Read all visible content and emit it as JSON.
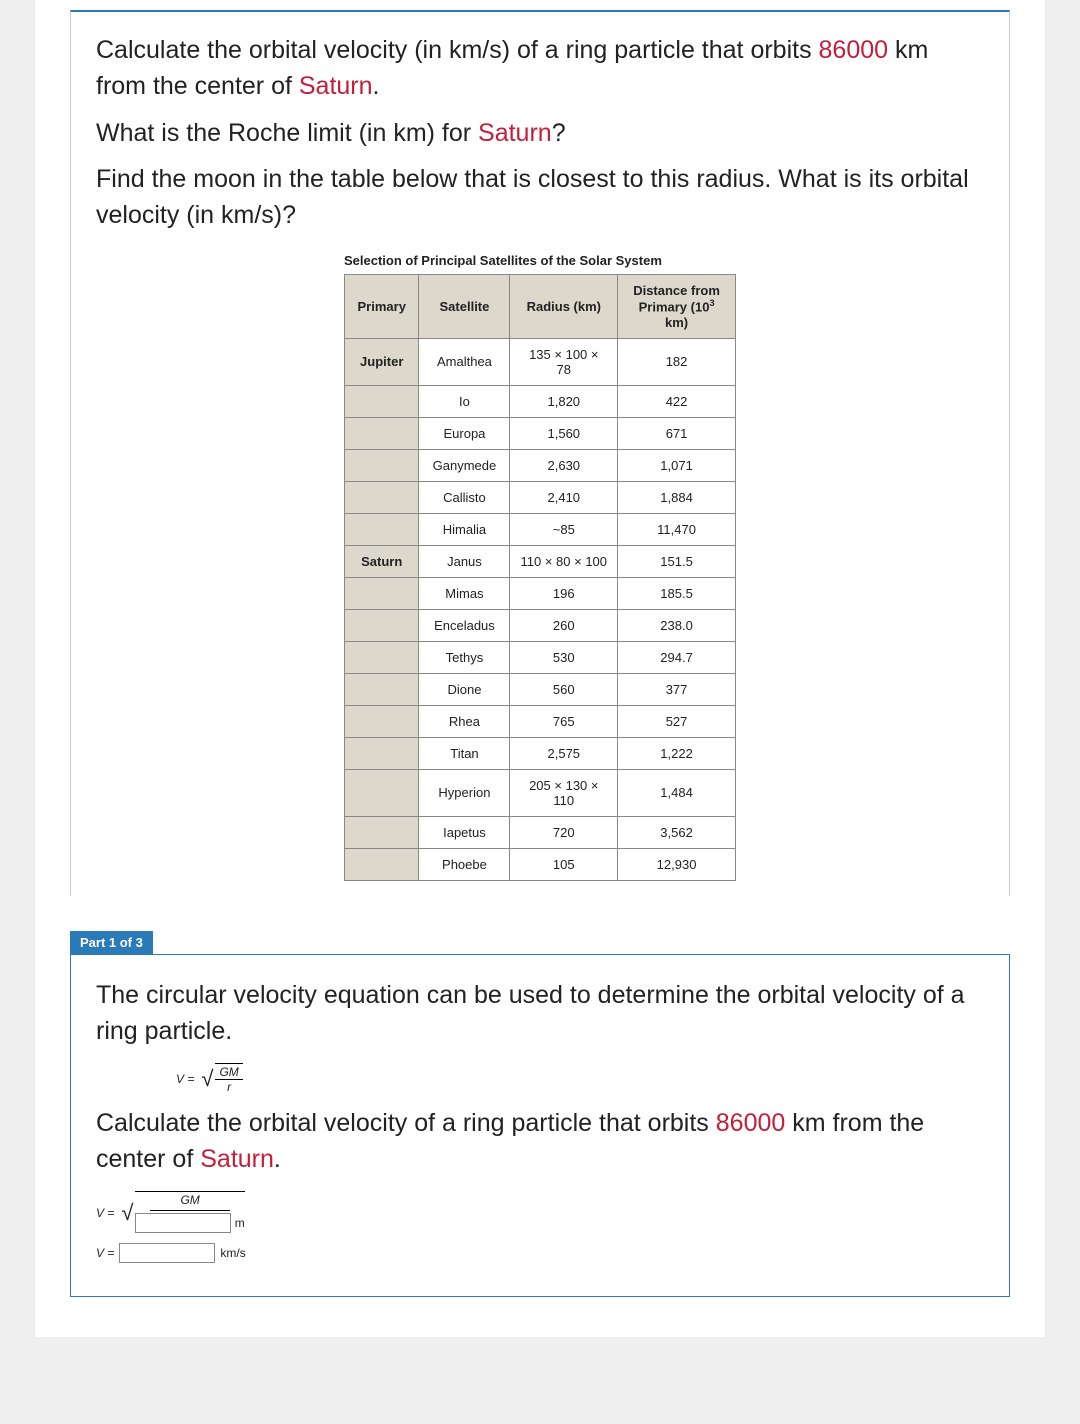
{
  "question": {
    "p1_pre": "Calculate the orbital velocity (in km/s) of a ring particle that orbits ",
    "p1_val": "86000",
    "p1_mid": " km from the center of ",
    "p1_planet": "Saturn",
    "p1_end": ".",
    "p2_pre": "What is the Roche limit (in km) for ",
    "p2_planet": "Saturn",
    "p2_end": "?",
    "p3": "Find the moon in the table below that is closest to this radius. What is its orbital velocity (in km/s)?"
  },
  "table": {
    "caption": "Selection of Principal Satellites of the Solar System",
    "headers": {
      "primary": "Primary",
      "satellite": "Satellite",
      "radius": "Radius (km)",
      "distance_pre": "Distance from Primary (10",
      "distance_sup": "3",
      "distance_post": " km)"
    },
    "rows": [
      {
        "primary": "Jupiter",
        "satellite": "Amalthea",
        "radius": "135 × 100 × 78",
        "distance": "182"
      },
      {
        "primary": "",
        "satellite": "Io",
        "radius": "1,820",
        "distance": "422"
      },
      {
        "primary": "",
        "satellite": "Europa",
        "radius": "1,560",
        "distance": "671"
      },
      {
        "primary": "",
        "satellite": "Ganymede",
        "radius": "2,630",
        "distance": "1,071"
      },
      {
        "primary": "",
        "satellite": "Callisto",
        "radius": "2,410",
        "distance": "1,884"
      },
      {
        "primary": "",
        "satellite": "Himalia",
        "radius": "~85",
        "distance": "11,470"
      },
      {
        "primary": "Saturn",
        "satellite": "Janus",
        "radius": "110 × 80 × 100",
        "distance": "151.5"
      },
      {
        "primary": "",
        "satellite": "Mimas",
        "radius": "196",
        "distance": "185.5"
      },
      {
        "primary": "",
        "satellite": "Enceladus",
        "radius": "260",
        "distance": "238.0"
      },
      {
        "primary": "",
        "satellite": "Tethys",
        "radius": "530",
        "distance": "294.7"
      },
      {
        "primary": "",
        "satellite": "Dione",
        "radius": "560",
        "distance": "377"
      },
      {
        "primary": "",
        "satellite": "Rhea",
        "radius": "765",
        "distance": "527"
      },
      {
        "primary": "",
        "satellite": "Titan",
        "radius": "2,575",
        "distance": "1,222"
      },
      {
        "primary": "",
        "satellite": "Hyperion",
        "radius": "205 × 130 × 110",
        "distance": "1,484"
      },
      {
        "primary": "",
        "satellite": "Iapetus",
        "radius": "720",
        "distance": "3,562"
      },
      {
        "primary": "",
        "satellite": "Phoebe",
        "radius": "105",
        "distance": "12,930"
      }
    ]
  },
  "part": {
    "header": "Part 1 of 3",
    "text1": "The circular velocity equation can be used to determine the orbital velocity of a ring particle.",
    "formula": {
      "lhs": "V =",
      "num": "GM",
      "den": "r"
    },
    "text2_pre": "Calculate the orbital velocity of a ring particle that orbits ",
    "text2_val": "86000",
    "text2_mid": " km from the center of ",
    "text2_planet": "Saturn",
    "text2_end": ".",
    "ans1": {
      "lhs": "V =",
      "num": "GM",
      "unit": "m"
    },
    "ans2": {
      "lhs": "V =",
      "unit": "km/s"
    }
  }
}
